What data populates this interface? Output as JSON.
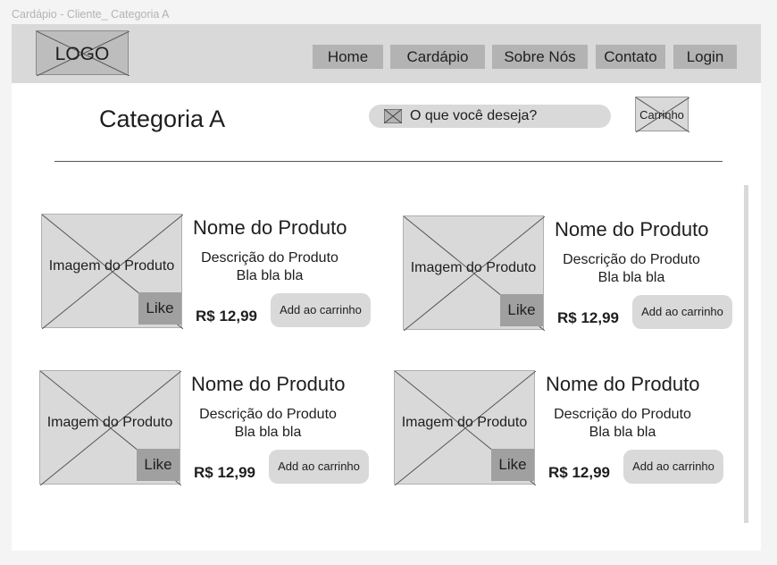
{
  "frame_label": "Cardápio - Cliente_ Categoria A",
  "header": {
    "logo": "LOGO",
    "nav": [
      "Home",
      "Cardápio",
      "Sobre Nós",
      "Contato",
      "Login"
    ]
  },
  "page_title": "Categoria A",
  "search": {
    "placeholder": "O que você deseja?"
  },
  "cart": {
    "label": "Carrinho"
  },
  "products": [
    {
      "image_label": "Imagem do Produto",
      "like": "Like",
      "name": "Nome do Produto",
      "desc1": "Descrição do Produto",
      "desc2": "Bla bla bla",
      "price": "R$ 12,99",
      "add_label": "Add ao carrinho"
    },
    {
      "image_label": "Imagem do Produto",
      "like": "Like",
      "name": "Nome do Produto",
      "desc1": "Descrição do Produto",
      "desc2": "Bla bla bla",
      "price": "R$ 12,99",
      "add_label": "Add ao carrinho"
    },
    {
      "image_label": "Imagem do Produto",
      "like": "Like",
      "name": "Nome do Produto",
      "desc1": "Descrição do Produto",
      "desc2": "Bla bla bla",
      "price": "R$ 12,99",
      "add_label": "Add ao carrinho"
    },
    {
      "image_label": "Imagem do Produto",
      "like": "Like",
      "name": "Nome do Produto",
      "desc1": "Descrição do Produto",
      "desc2": "Bla bla bla",
      "price": "R$ 12,99",
      "add_label": "Add ao carrinho"
    }
  ]
}
